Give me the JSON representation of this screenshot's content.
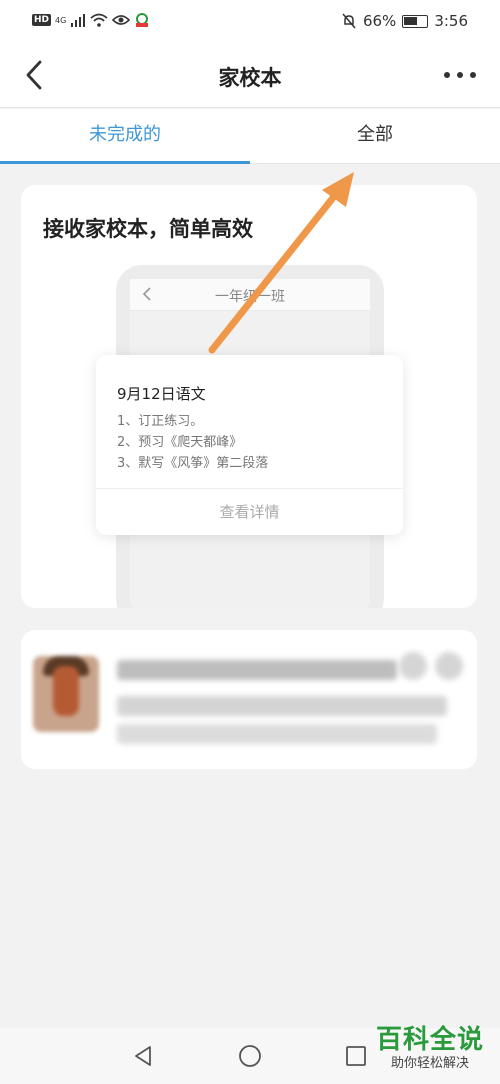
{
  "status_bar": {
    "hd_badge": "HD",
    "network": "4G",
    "battery_percent": "66%",
    "battery_level": 0.66,
    "time": "3:56"
  },
  "header": {
    "title": "家校本",
    "back_icon": "chevron-left-icon",
    "more_icon": "more-dots-icon"
  },
  "tabs": [
    {
      "label": "未完成的",
      "active": true
    },
    {
      "label": "全部",
      "active": false
    }
  ],
  "promo_card": {
    "title": "接收家校本，简单高效",
    "phone_title": "一年级一班",
    "homework": {
      "date": "9月12日语文",
      "items": [
        "1、订正练习。",
        "2、预习《爬天都峰》",
        "3、默写《风筝》第二段落"
      ],
      "detail_link": "查看详情"
    }
  },
  "annotation_arrow": {
    "color": "#f0984a"
  },
  "colors": {
    "accent": "#3e97d8",
    "background": "#f2f2f3",
    "watermark_green": "#2a9a3c"
  },
  "bottom_nav": {
    "back_icon": "triangle-back-icon",
    "home_icon": "circle-home-icon",
    "recent_icon": "square-recent-icon"
  },
  "watermark": {
    "main": "百科全说",
    "sub": "助你轻松解决"
  }
}
